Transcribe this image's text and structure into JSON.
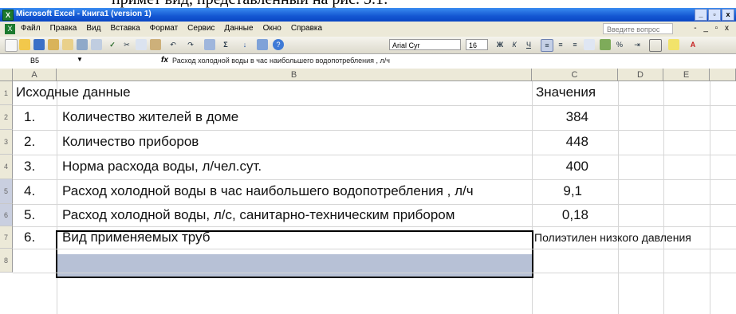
{
  "doc_text_above": "примет вид, представленный на рис. 5.1:",
  "window": {
    "title": "Microsoft Excel - Книга1 (version 1)",
    "controls": [
      "_",
      "▫",
      "x"
    ]
  },
  "menu": {
    "items": [
      "Файл",
      "Правка",
      "Вид",
      "Вставка",
      "Формат",
      "Сервис",
      "Данные",
      "Окно",
      "Справка"
    ],
    "ask_placeholder": "Введите вопрос",
    "window_controls": "- _ ▫ x"
  },
  "toolbar": {
    "font_name": "Arial Cyr",
    "font_size": "16",
    "icons": [
      "new-icon",
      "open-icon",
      "save-icon",
      "permission-icon",
      "email-icon",
      "print-icon",
      "preview-icon",
      "spelling-icon",
      "cut-icon",
      "copy-icon",
      "paste-icon",
      "undo-icon",
      "redo-icon",
      "hyperlink-icon",
      "autosum-icon",
      "sort-asc-icon",
      "chart-icon",
      "help-icon",
      "bold-icon",
      "italic-icon",
      "underline-icon",
      "align-left-icon",
      "align-center-icon",
      "align-right-icon",
      "merge-icon",
      "currency-icon",
      "percent-icon",
      "indent-icon",
      "borders-icon",
      "fill-color-icon",
      "font-color-icon"
    ]
  },
  "formula_bar": {
    "name_box": "B5",
    "fx": "fx",
    "content": "Расход холодной воды в час наибольшего водопотребления , л/ч"
  },
  "columns": [
    "A",
    "B",
    "C",
    "D",
    "E"
  ],
  "rows": [
    {
      "num": "1",
      "a": "Исходные данные",
      "b": "",
      "c": "Значения"
    },
    {
      "num": "2",
      "a": "1.",
      "b": "Количество жителей в доме",
      "c": "384"
    },
    {
      "num": "3",
      "a": "2.",
      "b": "Количество приборов",
      "c": "448"
    },
    {
      "num": "4",
      "a": "3.",
      "b": "Норма расхода воды, л/чел.сут.",
      "c": "400"
    },
    {
      "num": "5",
      "a": "4.",
      "b": "Расход холодной воды в час наибольшего водопотребления , л/ч",
      "c": "9,1"
    },
    {
      "num": "6",
      "a": "5.",
      "b": "Расход холодной воды, л/с, санитарно-техническим прибором",
      "c": "0,18"
    },
    {
      "num": "7",
      "a": "6.",
      "b": "Вид применяемых труб",
      "c": "Полиэтилен низкого давления"
    },
    {
      "num": "8",
      "a": "",
      "b": "",
      "c": ""
    }
  ],
  "colors": {
    "selection": "#b7c1d6",
    "header_bg": "#ece9d8",
    "title_bar": "#1457d2"
  }
}
